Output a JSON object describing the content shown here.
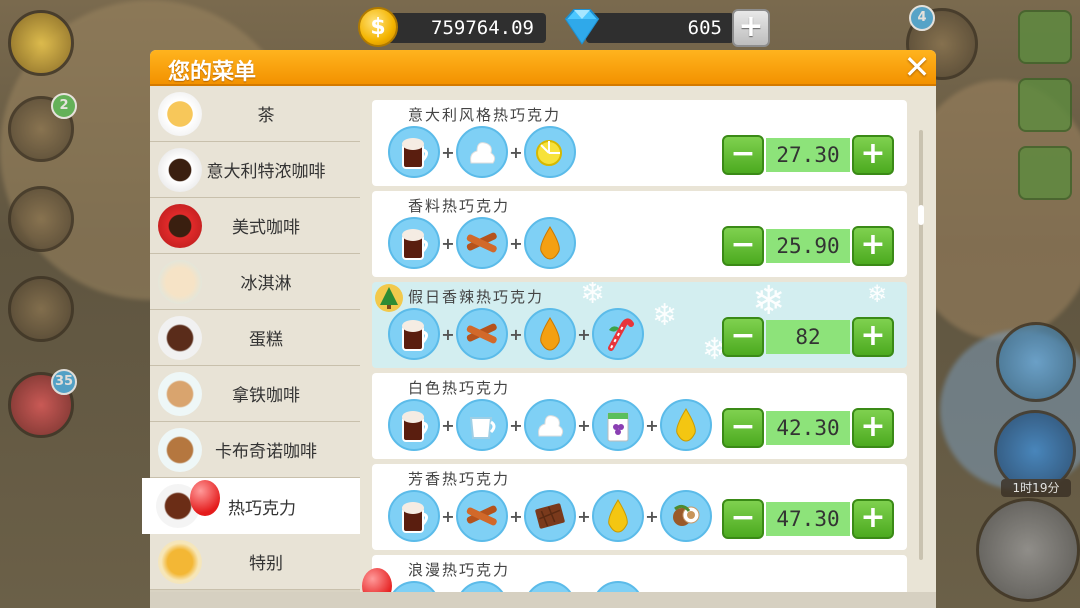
{
  "currency": {
    "coins": "759764.09",
    "gems": "605",
    "add_label": "+"
  },
  "side_badges": {
    "book": "2",
    "gift": "35",
    "avatar": "4"
  },
  "side_timer": "1时19分",
  "panel": {
    "title": "您的菜单",
    "close": "✕"
  },
  "categories": [
    {
      "label": "茶"
    },
    {
      "label": "意大利特浓咖啡"
    },
    {
      "label": "美式咖啡"
    },
    {
      "label": "冰淇淋"
    },
    {
      "label": "蛋糕"
    },
    {
      "label": "拿铁咖啡"
    },
    {
      "label": "卡布奇诺咖啡"
    },
    {
      "label": "热巧克力",
      "active": true
    },
    {
      "label": "特别"
    }
  ],
  "recipes": [
    {
      "name": "意大利风格热巧克力",
      "price": "27.30",
      "ingredients": [
        "hot-chocolate-icon",
        "whipped-cream-icon",
        "lemon-icon"
      ]
    },
    {
      "name": "香料热巧克力",
      "price": "25.90",
      "ingredients": [
        "hot-chocolate-icon",
        "cinnamon-icon",
        "syrup-drop-icon"
      ]
    },
    {
      "name": "假日香辣热巧克力",
      "price": "82",
      "holiday": true,
      "ingredients": [
        "hot-chocolate-icon",
        "cinnamon-icon",
        "syrup-drop-icon",
        "candy-cane-icon"
      ]
    },
    {
      "name": "白色热巧克力",
      "price": "42.30",
      "ingredients": [
        "hot-chocolate-icon",
        "milk-jug-icon",
        "whipped-cream-icon",
        "grape-juice-icon",
        "honey-drop-icon"
      ]
    },
    {
      "name": "芳香热巧克力",
      "price": "47.30",
      "ingredients": [
        "hot-chocolate-icon",
        "cinnamon-icon",
        "chocolate-bar-icon",
        "honey-drop-icon",
        "hazelnut-icon"
      ]
    },
    {
      "name": "浪漫热巧克力"
    }
  ],
  "buttons": {
    "minus": "−",
    "plus": "+"
  },
  "colors": {
    "header": "#f39200",
    "price_field": "#8de37a",
    "button_green": "#4caa1f",
    "ingredient_bg": "#7fd0f5"
  }
}
